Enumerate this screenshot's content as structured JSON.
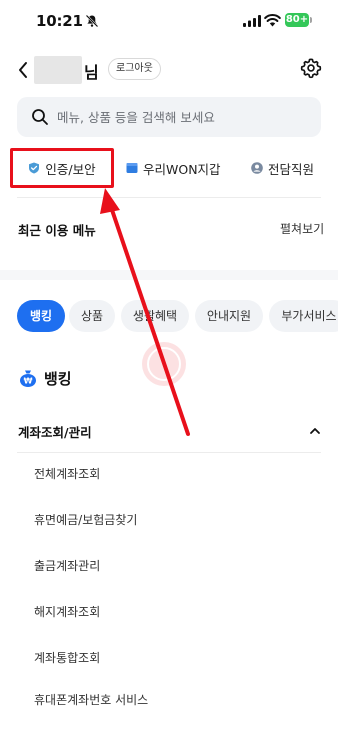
{
  "status_bar": {
    "time": "10:21",
    "battery": "80+"
  },
  "header": {
    "name_suffix": "님",
    "logout_label": "로그아웃"
  },
  "search": {
    "placeholder": "메뉴, 상품 등을 검색해 보세요"
  },
  "quick_menu": [
    {
      "label": "인증/보안",
      "icon": "shield-check-icon"
    },
    {
      "label": "우리WON지갑",
      "icon": "wallet-icon"
    },
    {
      "label": "전담직원",
      "icon": "person-icon"
    }
  ],
  "recent": {
    "title": "최근 이용 메뉴",
    "expand_label": "펼쳐보기"
  },
  "chips": [
    "뱅킹",
    "상품",
    "생활혜택",
    "안내지원",
    "부가서비스"
  ],
  "section": {
    "title": "뱅킹",
    "icon": "money-bag-icon"
  },
  "group": {
    "title": "계좌조회/관리",
    "items": [
      "전체계좌조회",
      "휴면예금/보험금찾기",
      "출금계좌관리",
      "해지계좌조회",
      "계좌통합조회",
      "휴대폰계좌번호 서비스"
    ]
  },
  "colors": {
    "accent": "#1e6ff0",
    "annotation": "#e8101b",
    "battery": "#34c759"
  }
}
